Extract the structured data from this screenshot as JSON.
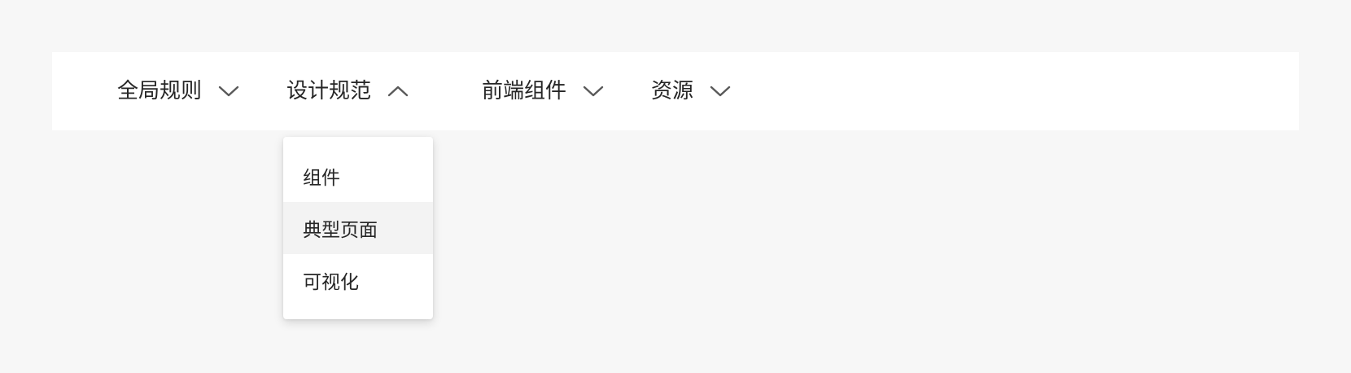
{
  "nav": {
    "items": [
      {
        "label": "全局规则",
        "expanded": false,
        "icon": "chevron-down-icon"
      },
      {
        "label": "设计规范",
        "expanded": true,
        "icon": "chevron-up-icon"
      },
      {
        "label": "前端组件",
        "expanded": false,
        "icon": "chevron-down-icon"
      },
      {
        "label": "资源",
        "expanded": false,
        "icon": "chevron-down-icon"
      }
    ]
  },
  "dropdown": {
    "parent": "设计规范",
    "items": [
      {
        "label": "组件"
      },
      {
        "label": "典型页面",
        "state": "hovered"
      },
      {
        "label": "可视化"
      }
    ]
  },
  "colors": {
    "background": "#f7f7f7",
    "surface": "#ffffff",
    "text": "#262626",
    "icon": "#595959",
    "hover": "#f3f3f3"
  }
}
